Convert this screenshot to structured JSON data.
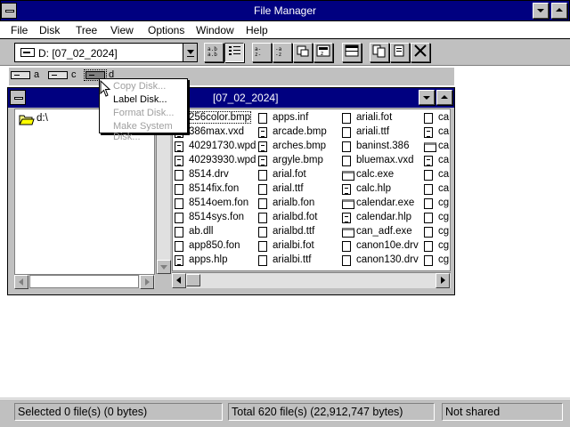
{
  "app": {
    "title": "File Manager"
  },
  "menubar": [
    "File",
    "Disk",
    "Tree",
    "View",
    "Options",
    "Window",
    "Help"
  ],
  "toolbar": {
    "drive_combo": "D: [07_02_2024]"
  },
  "drives": [
    {
      "letter": "a"
    },
    {
      "letter": "c"
    },
    {
      "letter": "d"
    }
  ],
  "doc_window": {
    "title": "[07_02_2024]"
  },
  "tree": {
    "root": "d:\\"
  },
  "disk_menu": {
    "items": [
      {
        "label": "Copy Disk...",
        "enabled": false
      },
      {
        "label": "Label Disk...",
        "enabled": true
      },
      {
        "label": "Format Disk...",
        "enabled": false
      },
      {
        "label": "Make System Disk...",
        "enabled": false
      }
    ]
  },
  "files": {
    "col1": [
      "256color.bmp",
      "386max.vxd",
      "40291730.wpd",
      "40293930.wpd",
      "8514.drv",
      "8514fix.fon",
      "8514oem.fon",
      "8514sys.fon",
      "ab.dll",
      "app850.fon",
      "apps.hlp"
    ],
    "col2": [
      "apps.inf",
      "arcade.bmp",
      "arches.bmp",
      "argyle.bmp",
      "arial.fot",
      "arial.ttf",
      "arialb.fon",
      "arialbd.fot",
      "arialbd.ttf",
      "arialbi.fot",
      "arialbi.ttf"
    ],
    "col3": [
      "ariali.fot",
      "ariali.ttf",
      "baninst.386",
      "bluemax.vxd",
      "calc.exe",
      "calc.hlp",
      "calendar.exe",
      "calendar.hlp",
      "can_adf.exe",
      "canon10e.drv",
      "canon130.drv"
    ],
    "col4": [
      "ca",
      "ca",
      "ca",
      "ca",
      "ca",
      "ca",
      "cg",
      "cg",
      "cg",
      "cg",
      "cg"
    ]
  },
  "status": {
    "selected": "Selected 0 file(s) (0 bytes)",
    "total": "Total 620 file(s) (22,912,747 bytes)",
    "share": "Not shared"
  },
  "colors": {
    "title_active": "#000080",
    "face": "#c0c0c0"
  }
}
